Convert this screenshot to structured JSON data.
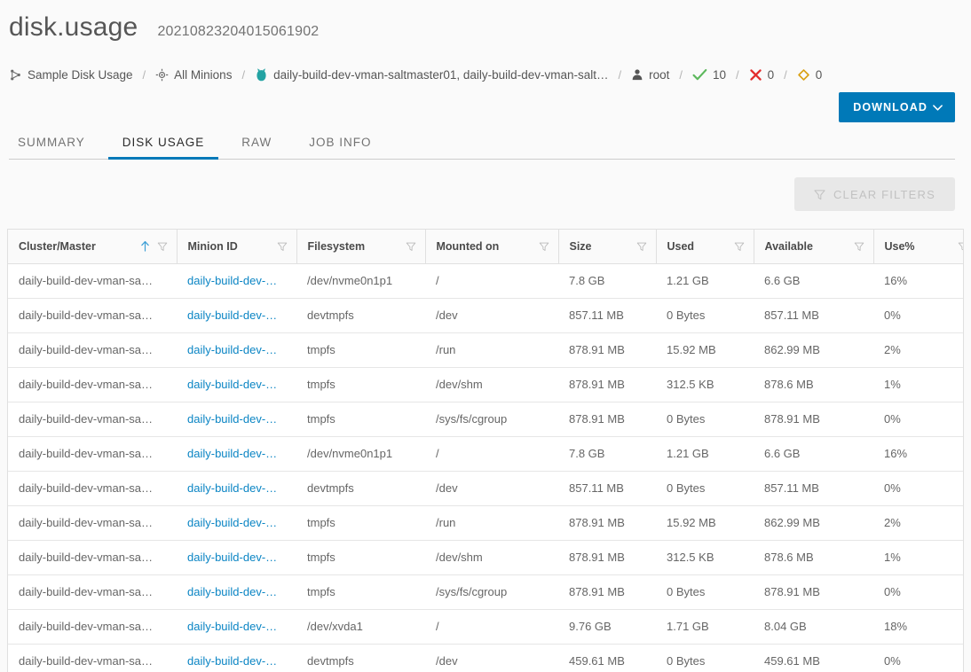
{
  "header": {
    "title": "disk.usage",
    "job_id": "20210823204015061902"
  },
  "breadcrumb": {
    "items": [
      {
        "icon": "cluster-icon",
        "label": "Sample Disk Usage"
      },
      {
        "icon": "target-icon",
        "label": "All Minions"
      },
      {
        "icon": "salt-minion-icon",
        "label": "daily-build-dev-vman-saltmaster01, daily-build-dev-vman-salt…"
      },
      {
        "icon": "user-icon",
        "label": "root"
      },
      {
        "icon": "check-icon",
        "label": "10"
      },
      {
        "icon": "cross-icon",
        "label": "0"
      },
      {
        "icon": "diamond-icon",
        "label": "0"
      }
    ],
    "separator": "/"
  },
  "toolbar": {
    "download_label": "DOWNLOAD",
    "download_caret": "chevron-down-icon",
    "clear_filters_label": "CLEAR FILTERS"
  },
  "tabs": [
    {
      "label": "SUMMARY",
      "active": false
    },
    {
      "label": "DISK USAGE",
      "active": true
    },
    {
      "label": "RAW",
      "active": false
    },
    {
      "label": "JOB INFO",
      "active": false
    }
  ],
  "table": {
    "columns": [
      {
        "label": "Cluster/Master",
        "sorted": "asc",
        "filterable": true
      },
      {
        "label": "Minion ID",
        "sorted": null,
        "filterable": true
      },
      {
        "label": "Filesystem",
        "sorted": null,
        "filterable": true
      },
      {
        "label": "Mounted on",
        "sorted": null,
        "filterable": true
      },
      {
        "label": "Size",
        "sorted": null,
        "filterable": true
      },
      {
        "label": "Used",
        "sorted": null,
        "filterable": true
      },
      {
        "label": "Available",
        "sorted": null,
        "filterable": true
      },
      {
        "label": "Use%",
        "sorted": null,
        "filterable": true
      }
    ],
    "rows": [
      {
        "cluster": "daily-build-dev-vman-sa…",
        "minion": "daily-build-dev-…",
        "filesystem": "/dev/nvme0n1p1",
        "mounted_on": "/",
        "size": "7.8 GB",
        "used": "1.21 GB",
        "available": "6.6 GB",
        "use_pct": "16%"
      },
      {
        "cluster": "daily-build-dev-vman-sa…",
        "minion": "daily-build-dev-…",
        "filesystem": "devtmpfs",
        "mounted_on": "/dev",
        "size": "857.11 MB",
        "used": "0 Bytes",
        "available": "857.11 MB",
        "use_pct": "0%"
      },
      {
        "cluster": "daily-build-dev-vman-sa…",
        "minion": "daily-build-dev-…",
        "filesystem": "tmpfs",
        "mounted_on": "/run",
        "size": "878.91 MB",
        "used": "15.92 MB",
        "available": "862.99 MB",
        "use_pct": "2%"
      },
      {
        "cluster": "daily-build-dev-vman-sa…",
        "minion": "daily-build-dev-…",
        "filesystem": "tmpfs",
        "mounted_on": "/dev/shm",
        "size": "878.91 MB",
        "used": "312.5 KB",
        "available": "878.6 MB",
        "use_pct": "1%"
      },
      {
        "cluster": "daily-build-dev-vman-sa…",
        "minion": "daily-build-dev-…",
        "filesystem": "tmpfs",
        "mounted_on": "/sys/fs/cgroup",
        "size": "878.91 MB",
        "used": "0 Bytes",
        "available": "878.91 MB",
        "use_pct": "0%"
      },
      {
        "cluster": "daily-build-dev-vman-sa…",
        "minion": "daily-build-dev-…",
        "filesystem": "/dev/nvme0n1p1",
        "mounted_on": "/",
        "size": "7.8 GB",
        "used": "1.21 GB",
        "available": "6.6 GB",
        "use_pct": "16%"
      },
      {
        "cluster": "daily-build-dev-vman-sa…",
        "minion": "daily-build-dev-…",
        "filesystem": "devtmpfs",
        "mounted_on": "/dev",
        "size": "857.11 MB",
        "used": "0 Bytes",
        "available": "857.11 MB",
        "use_pct": "0%"
      },
      {
        "cluster": "daily-build-dev-vman-sa…",
        "minion": "daily-build-dev-…",
        "filesystem": "tmpfs",
        "mounted_on": "/run",
        "size": "878.91 MB",
        "used": "15.92 MB",
        "available": "862.99 MB",
        "use_pct": "2%"
      },
      {
        "cluster": "daily-build-dev-vman-sa…",
        "minion": "daily-build-dev-…",
        "filesystem": "tmpfs",
        "mounted_on": "/dev/shm",
        "size": "878.91 MB",
        "used": "312.5 KB",
        "available": "878.6 MB",
        "use_pct": "1%"
      },
      {
        "cluster": "daily-build-dev-vman-sa…",
        "minion": "daily-build-dev-…",
        "filesystem": "tmpfs",
        "mounted_on": "/sys/fs/cgroup",
        "size": "878.91 MB",
        "used": "0 Bytes",
        "available": "878.91 MB",
        "use_pct": "0%"
      },
      {
        "cluster": "daily-build-dev-vman-sa…",
        "minion": "daily-build-dev-…",
        "filesystem": "/dev/xvda1",
        "mounted_on": "/",
        "size": "9.76 GB",
        "used": "1.71 GB",
        "available": "8.04 GB",
        "use_pct": "18%"
      },
      {
        "cluster": "daily-build-dev-vman-sa…",
        "minion": "daily-build-dev-…",
        "filesystem": "devtmpfs",
        "mounted_on": "/dev",
        "size": "459.61 MB",
        "used": "0 Bytes",
        "available": "459.61 MB",
        "use_pct": "0%"
      }
    ]
  },
  "colors": {
    "accent_blue": "#0079b8",
    "link_blue": "#0b85c4",
    "sort_blue": "#3d9fd6",
    "salt_teal": "#23a3a3",
    "success_green": "#5cb85c",
    "error_red": "#e32d2d",
    "warning_gold": "#d9a013",
    "page_bg": "#fafafa",
    "text": "#565656"
  }
}
